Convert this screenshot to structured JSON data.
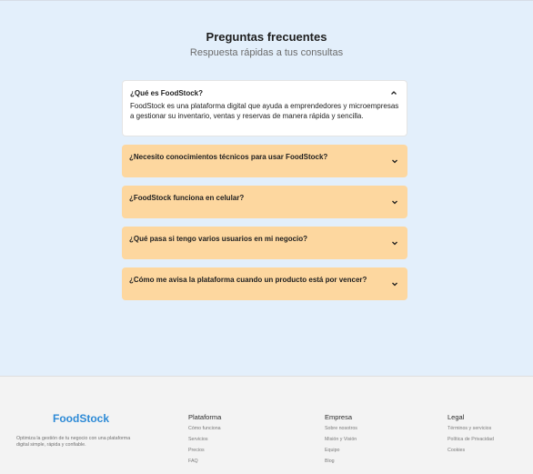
{
  "faq": {
    "title": "Preguntas frecuentes",
    "subtitle": "Respuesta rápidas a tus consultas",
    "items": [
      {
        "question": "¿Qué es FoodStock?",
        "answer": "FoodStock es una plataforma digital que ayuda a emprendedores y microempresas a gestionar su inventario, ventas y reservas de manera rápida y sencilla.",
        "expanded": true
      },
      {
        "question": "¿Necesito conocimientos técnicos para usar FoodStock?",
        "expanded": false
      },
      {
        "question": "¿FoodStock funciona en celular?",
        "expanded": false
      },
      {
        "question": "¿Qué pasa si tengo varios usuarios en mi negocio?",
        "expanded": false
      },
      {
        "question": "¿Cómo me avisa la plataforma cuando un producto está por vencer?",
        "expanded": false
      }
    ]
  },
  "footer": {
    "logo": "FoodStock",
    "tagline": "Optimiza la gestión de tu negocio con una plataforma digital simple, rápida y confiable.",
    "columns": [
      {
        "title": "Plataforma",
        "links": [
          "Cómo funciona",
          "Servicios",
          "Precios",
          "FAQ"
        ]
      },
      {
        "title": "Empresa",
        "links": [
          "Sobre nosotros",
          "Misión y Visión",
          "Equipo",
          "Blog"
        ]
      },
      {
        "title": "Legal",
        "links": [
          "Términos y servicios",
          "Política de Privacidad",
          "Cookies"
        ]
      }
    ]
  },
  "colors": {
    "section_bg": "#e3effb",
    "accent_card": "#fdd79f",
    "brand": "#2d8ad6",
    "footer_bg": "#f3f3f3"
  },
  "icons": {
    "expanded": "chevron-up-icon",
    "collapsed": "chevron-down-icon"
  }
}
